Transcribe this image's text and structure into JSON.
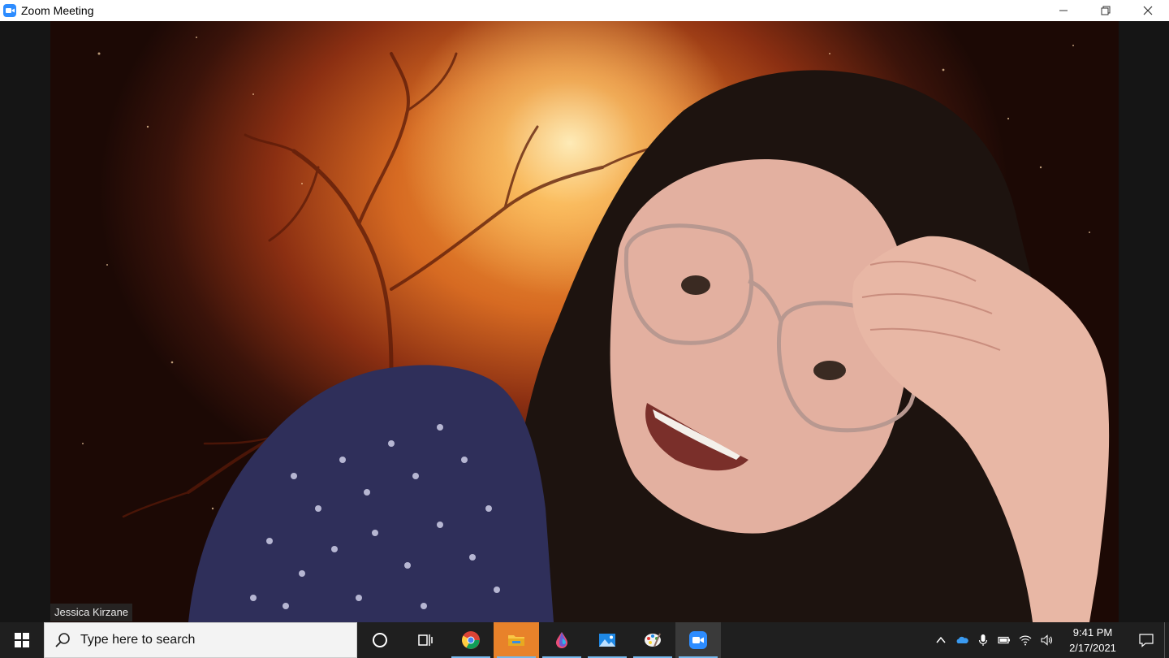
{
  "window": {
    "title": "Zoom Meeting",
    "app_icon": "zoom-camera-icon",
    "controls": [
      "minimize-icon",
      "restore-icon",
      "close-icon"
    ]
  },
  "video": {
    "participant_name": "Jessica Kirzane",
    "background": "orange-nebula-with-tree"
  },
  "taskbar": {
    "search_placeholder": "Type here to search",
    "pinned_apps": [
      "cortana-icon",
      "task-view-icon",
      "chrome-icon",
      "file-explorer-icon",
      "paint-drop-icon",
      "photos-icon",
      "paint-palette-icon",
      "zoom-icon"
    ],
    "active_app": "zoom-icon",
    "clock": {
      "time": "9:41 PM",
      "date": "2/17/2021"
    },
    "tray_icons": [
      "chevron-up-icon",
      "onedrive-icon",
      "microphone-icon",
      "battery-icon",
      "wifi-icon",
      "volume-icon"
    ]
  },
  "colors": {
    "zoom_blue": "#2d8cff",
    "taskbar": "#1f1f1f",
    "highlight": "#e8822a"
  }
}
